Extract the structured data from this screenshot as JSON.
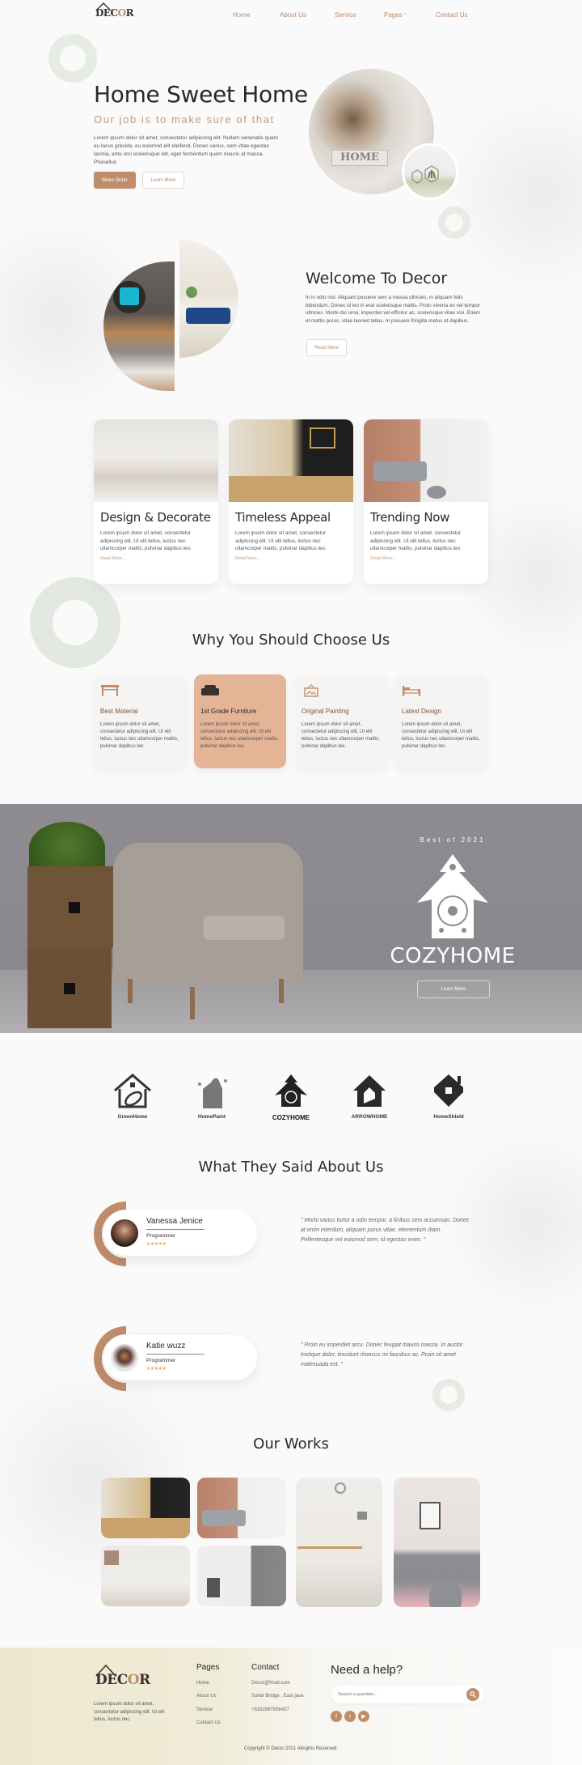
{
  "brand": {
    "logo_text": "DECOR"
  },
  "nav": {
    "items": [
      "Home",
      "About Us",
      "Service",
      "Pages",
      "Contact Us"
    ],
    "pages_chevron": "⌄"
  },
  "hero": {
    "title": "Home Sweet Home",
    "subtitle": "Our job is to make sure of that",
    "body": "Lorem ipsum dolor sit amet, consectetur adipiscing elit. Nullam venenatis quam eu lacus gravida, eu euismod elit eleifend. Donec varius, sem vitae egestas lacinia, ante orci scelerisque elit, eget fermentum quam mauris at massa. Phasellus",
    "primary_button": "Make Order",
    "secondary_button": "Learn More"
  },
  "welcome": {
    "title": "Welcome To Decor",
    "body": "In in odio nisi. Aliquam posuere sem a massa ultricies, in aliquam felis bibendum. Donec id leo in erat scelerisque mattis. Proin viverra ex vel tempor ultricies. Morbi dui urna, imperdiet vel efficitur ac, scelerisque vitae nisi. Etiam et mattis purus, vitae laoreet tellus. In posuere fringilla metus at dapibus.",
    "button": "Read More"
  },
  "features": [
    {
      "title": "Design & Decorate",
      "body": "Lorem ipsum dolor sit amet, consectetur adipiscing elit. Ut elit tellus, luctus nec ullamcorper mattis, pulvinar dapibus leo.",
      "link": "Read More..."
    },
    {
      "title": "Timeless Appeal",
      "body": "Lorem ipsum dolor sit amet, consectetur adipiscing elit. Ut elit tellus, luctus nec ullamcorper mattis, pulvinar dapibus leo.",
      "link": "Read More..."
    },
    {
      "title": "Trending Now",
      "body": "Lorem ipsum dolor sit amet, consectetur adipiscing elit. Ut elit tellus, luctus nec ullamcorper mattis, pulvinar dapibus leo.",
      "link": "Read More..."
    }
  ],
  "why": {
    "title": "Why You Should Choose Us",
    "items": [
      {
        "icon": "table-icon",
        "title": "Best Material",
        "body": "Lorem ipsum dolor sit amet, consectetur adipiscing elit. Ut elit tellus, luctus nec ullamcorper mattis, pulvinar dapibus leo."
      },
      {
        "icon": "armchair-icon",
        "title": "1st Grade Furniture",
        "body": "Lorem ipsum dolor sit amet, consectetur adipiscing elit. Ut elit tellus, luctus nec ullamcorper mattis, pulvinar dapibus leo."
      },
      {
        "icon": "painting-icon",
        "title": "Original Painting",
        "body": "Lorem ipsum dolor sit amet, consectetur adipiscing elit. Ut elit tellus, luctus nec ullamcorper mattis, pulvinar dapibus leo."
      },
      {
        "icon": "bed-icon",
        "title": "Latest Design",
        "body": "Lorem ipsum dolor sit amet, consectetur adipiscing elit. Ut elit tellus, luctus nec ullamcorper mattis, pulvinar dapibus leo."
      }
    ]
  },
  "banner": {
    "kicker": "Best of 2021",
    "brand": "COZYHOME",
    "button": "Learn More"
  },
  "partners": [
    "GreenHome",
    "HomePaint",
    "COZYHOME",
    "ARROWHOME",
    "HomeShield"
  ],
  "testimonials": {
    "title": "What They Said About Us",
    "items": [
      {
        "name": "Vanessa Jenice",
        "role": "Programmer",
        "stars": "★★★★★",
        "quote": "\" Morbi varius tortor a odio tempor, a finibus sem accumsan. Donec at enim interdum, aliquam purus vitae, elementum diam. Pellentesque vel euismod sem, id egestas enim. \""
      },
      {
        "name": "Katie wuzz",
        "role": "Programmer",
        "stars": "★★★★★",
        "quote": "\" Proin eu imperdiet arcu. Donec feugiat mauris massa. In auctor tristique dolor, tincidunt rhoncus mi faucibus ac. Proin sit amet malesuada est. \""
      }
    ]
  },
  "works": {
    "title": "Our Works"
  },
  "footer": {
    "about": "Lorem ipsum dolor sit amet, consectetur adipiscing elit. Ut elit tellus, luctus nec.",
    "pages_title": "Pages",
    "pages": [
      "Home",
      "About Us",
      "Service",
      "Contact Us"
    ],
    "contact_title": "Contact",
    "contact": [
      "Decor@fmail.com",
      "Suhat Bridge , East java",
      "+6282897656437"
    ],
    "help_title": "Need a help?",
    "search_placeholder": "Search a question...",
    "copyright": "Copyright © Decor 2021 Allrights Reserved."
  },
  "colors": {
    "accent": "#c08d6b",
    "accent_light": "#e5b497",
    "text": "#2c2729",
    "star": "#e8a93f"
  }
}
